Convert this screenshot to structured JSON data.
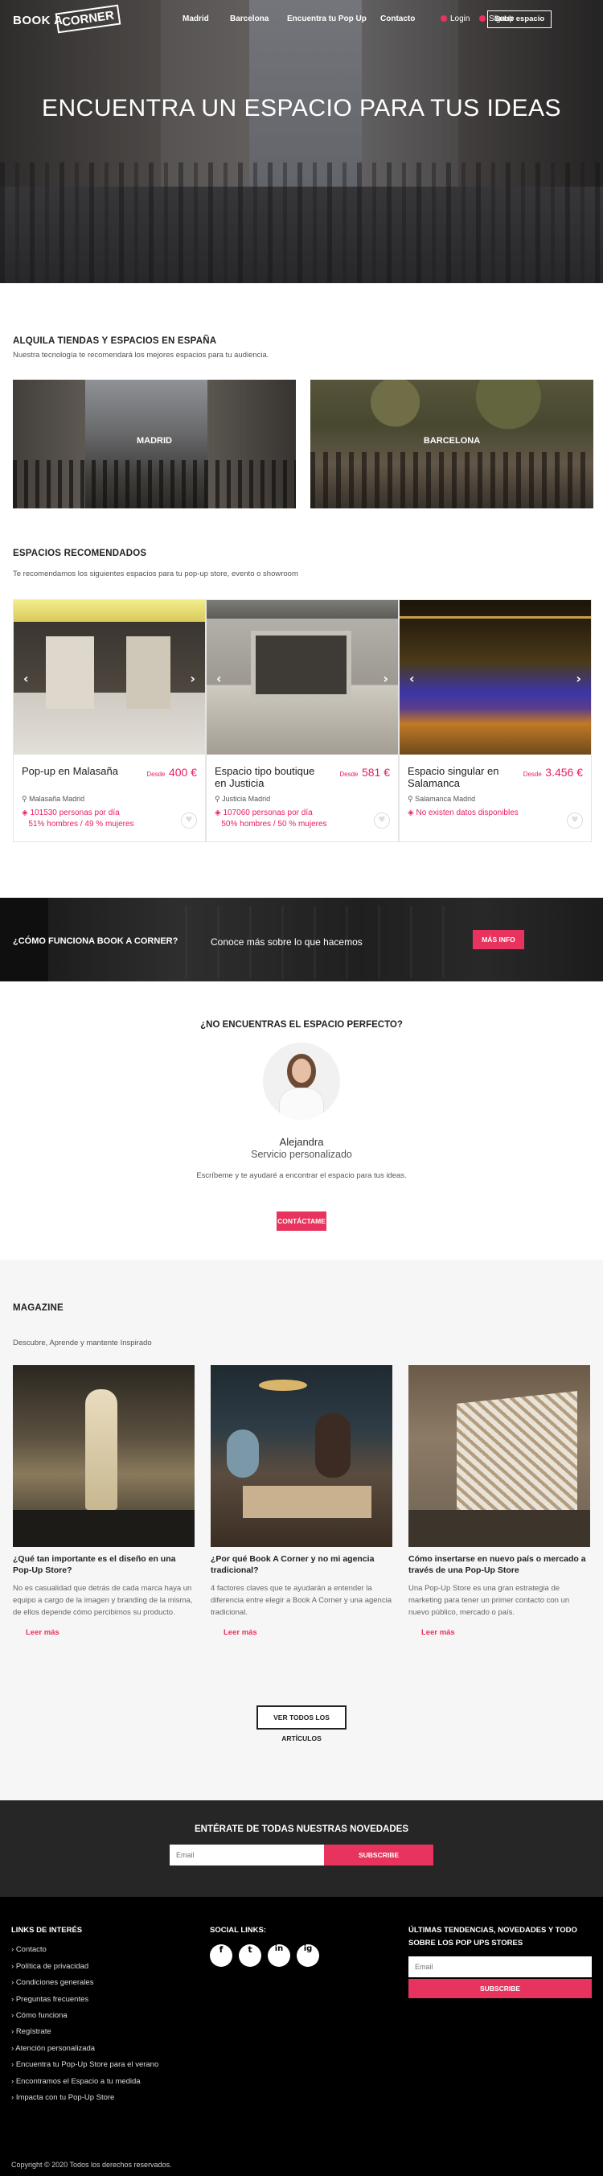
{
  "header": {
    "logo_left": "BOOK A",
    "logo_box": "CORNER",
    "nav": [
      "Madrid",
      "Barcelona",
      "Encuentra tu Pop Up",
      "Contacto"
    ],
    "login": "Login",
    "signup": "Signup",
    "upload_button": "Subir espacio"
  },
  "hero": {
    "title": "ENCUENTRA UN ESPACIO PARA TUS IDEAS"
  },
  "rent": {
    "title": "ALQUILA TIENDAS Y ESPACIOS EN ESPAÑA",
    "subtitle": "Nuestra tecnología te recomendará los mejores espacios para tu audiencia.",
    "cities": [
      "MADRID",
      "BARCELONA"
    ]
  },
  "recommended": {
    "title": "ESPACIOS RECOMENDADOS",
    "subtitle": "Te recomendamos los siguientes espacios para tu pop-up store, evento o showroom",
    "cards": [
      {
        "title": "Pop-up en Malasaña",
        "from": "Desde",
        "price": "400 €",
        "location": "Malasaña Madrid",
        "stat1": "101530 personas por día",
        "stat2": "51% hombres / 49 % mujeres"
      },
      {
        "title": "Espacio tipo boutique en Justicia",
        "from": "Desde",
        "price": "581 €",
        "location": "Justicia Madrid",
        "stat1": "107060 personas por día",
        "stat2": "50% hombres / 50 % mujeres"
      },
      {
        "title": "Espacio singular en Salamanca",
        "from": "Desde",
        "price": "3.456 €",
        "location": "Salamanca Madrid",
        "stat1": "No existen datos disponibles",
        "stat2": ""
      }
    ]
  },
  "how": {
    "question": "¿CÓMO FUNCIONA BOOK A CORNER?",
    "text": "Conoce más sobre lo que hacemos",
    "button": "MÁS INFO"
  },
  "contact": {
    "title": "¿NO ENCUENTRAS EL ESPACIO PERFECTO?",
    "name": "Alejandra",
    "role": "Servicio personalizado",
    "text": "Escríbeme y te ayudaré a encontrar el espacio para tus ideas.",
    "button": "CONTÁCTAME"
  },
  "magazine": {
    "title": "MAGAZINE",
    "subtitle": "Descubre, Aprende y mantente Inspirado",
    "posts": [
      {
        "title": "¿Qué tan importante es el diseño en una Pop-Up Store?",
        "desc": "No es casualidad que detrás de cada marca haya un equipo a cargo de la imagen y branding de la misma, de ellos depende cómo percibimos su producto.",
        "more": "Leer más"
      },
      {
        "title": "¿Por qué Book A Corner y no mi agencia tradicional?",
        "desc": "4 factores claves que te ayudarán a entender la diferencia entre elegir a Book A Corner y una agencia tradicional.",
        "more": "Leer más"
      },
      {
        "title": "Cómo insertarse en nuevo país o mercado a través de una Pop-Up Store",
        "desc": "Una Pop-Up Store es una gran estrategia de marketing para tener un primer contacto con un nuevo público, mercado o país.",
        "more": "Leer más"
      }
    ],
    "all_button": "VER TODOS LOS ARTÍCULOS"
  },
  "newsletter": {
    "title": "ENTÉRATE DE TODAS NUESTRAS NOVEDADES",
    "placeholder": "Email",
    "button": "SUBSCRIBE"
  },
  "footer": {
    "links_title": "LINKS DE INTERÉS",
    "links": [
      "Contacto",
      "Política de privacidad",
      "Condiciones generales",
      "Preguntas frecuentes",
      "Cómo funciona",
      "Regístrate",
      "Atención personalizada",
      "Encuentra tu Pop-Up Store para el verano",
      "Encontramos el Espacio a tu medida",
      "Impacta con tu Pop-Up Store"
    ],
    "social_title": "SOCIAL LINKS:",
    "social": [
      "f",
      "t",
      "in",
      "ig"
    ],
    "news_title": "ÚLTIMAS TENDENCIAS, NOVEDADES Y TODO SOBRE LOS POP UPS STORES",
    "email_placeholder": "Email",
    "subscribe": "SUBSCRIBE",
    "copyright": "Copyright © 2020 Todos los derechos reservados."
  },
  "colors": {
    "accent": "#e8335e",
    "dark": "#262626",
    "footer": "#000000"
  }
}
